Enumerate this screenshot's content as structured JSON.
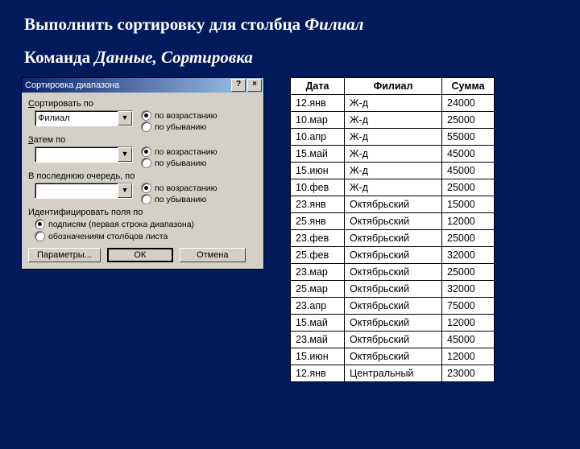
{
  "heading1_plain": "Выполнить сортировку для столбца ",
  "heading1_italic": "Филиал",
  "heading2_plain": "Команда ",
  "heading2_italic": "Данные, Сортировка",
  "dialog": {
    "title": "Сортировка диапазона",
    "help": "?",
    "close": "×",
    "sort_by": "Сортировать по",
    "sort_by_u": "С",
    "then_by": "Затем по",
    "then_by_u": "З",
    "last_by": "В последнюю очередь, по",
    "asc_pref": "по возраст",
    "asc_u": "а",
    "asc_suf": "нию",
    "desc_pref": "по убыван",
    "desc_u": "и",
    "desc_suf": "ю",
    "combo1": "Филиал",
    "combo2": "",
    "combo3": "",
    "ident": "Идентифицировать поля по",
    "ident_opt1_pref": "",
    "ident_opt1_u": "п",
    "ident_opt1_suf": "одписям (первая строка диапазона)",
    "ident_opt2_pref": "о",
    "ident_opt2_u": "б",
    "ident_opt2_suf": "означениям столбцов листа",
    "btn_params": "Параметры...",
    "btn_ok": "ОК",
    "btn_cancel": "Отмена",
    "arrow": "▼"
  },
  "table": {
    "headers": [
      "Дата",
      "Филиал",
      "Сумма"
    ],
    "rows": [
      [
        "12.янв",
        "Ж-д",
        "24000"
      ],
      [
        "10.мар",
        "Ж-д",
        "25000"
      ],
      [
        "10.апр",
        "Ж-д",
        "55000"
      ],
      [
        "15.май",
        "Ж-д",
        "45000"
      ],
      [
        "15.июн",
        "Ж-д",
        "45000"
      ],
      [
        "10.фев",
        "Ж-д",
        "25000"
      ],
      [
        "23.янв",
        "Октябрьский",
        "15000"
      ],
      [
        "25.янв",
        "Октябрьский",
        "12000"
      ],
      [
        "23.фев",
        "Октябрьский",
        "25000"
      ],
      [
        "25.фев",
        "Октябрьский",
        "32000"
      ],
      [
        "23.мар",
        "Октябрьский",
        "25000"
      ],
      [
        "25.мар",
        "Октябрьский",
        "32000"
      ],
      [
        "23.апр",
        "Октябрьский",
        "75000"
      ],
      [
        "15.май",
        "Октябрьский",
        "12000"
      ],
      [
        "23.май",
        "Октябрьский",
        "45000"
      ],
      [
        "15.июн",
        "Октябрьский",
        "12000"
      ],
      [
        "12.янв",
        "Центральный",
        "23000"
      ]
    ]
  }
}
